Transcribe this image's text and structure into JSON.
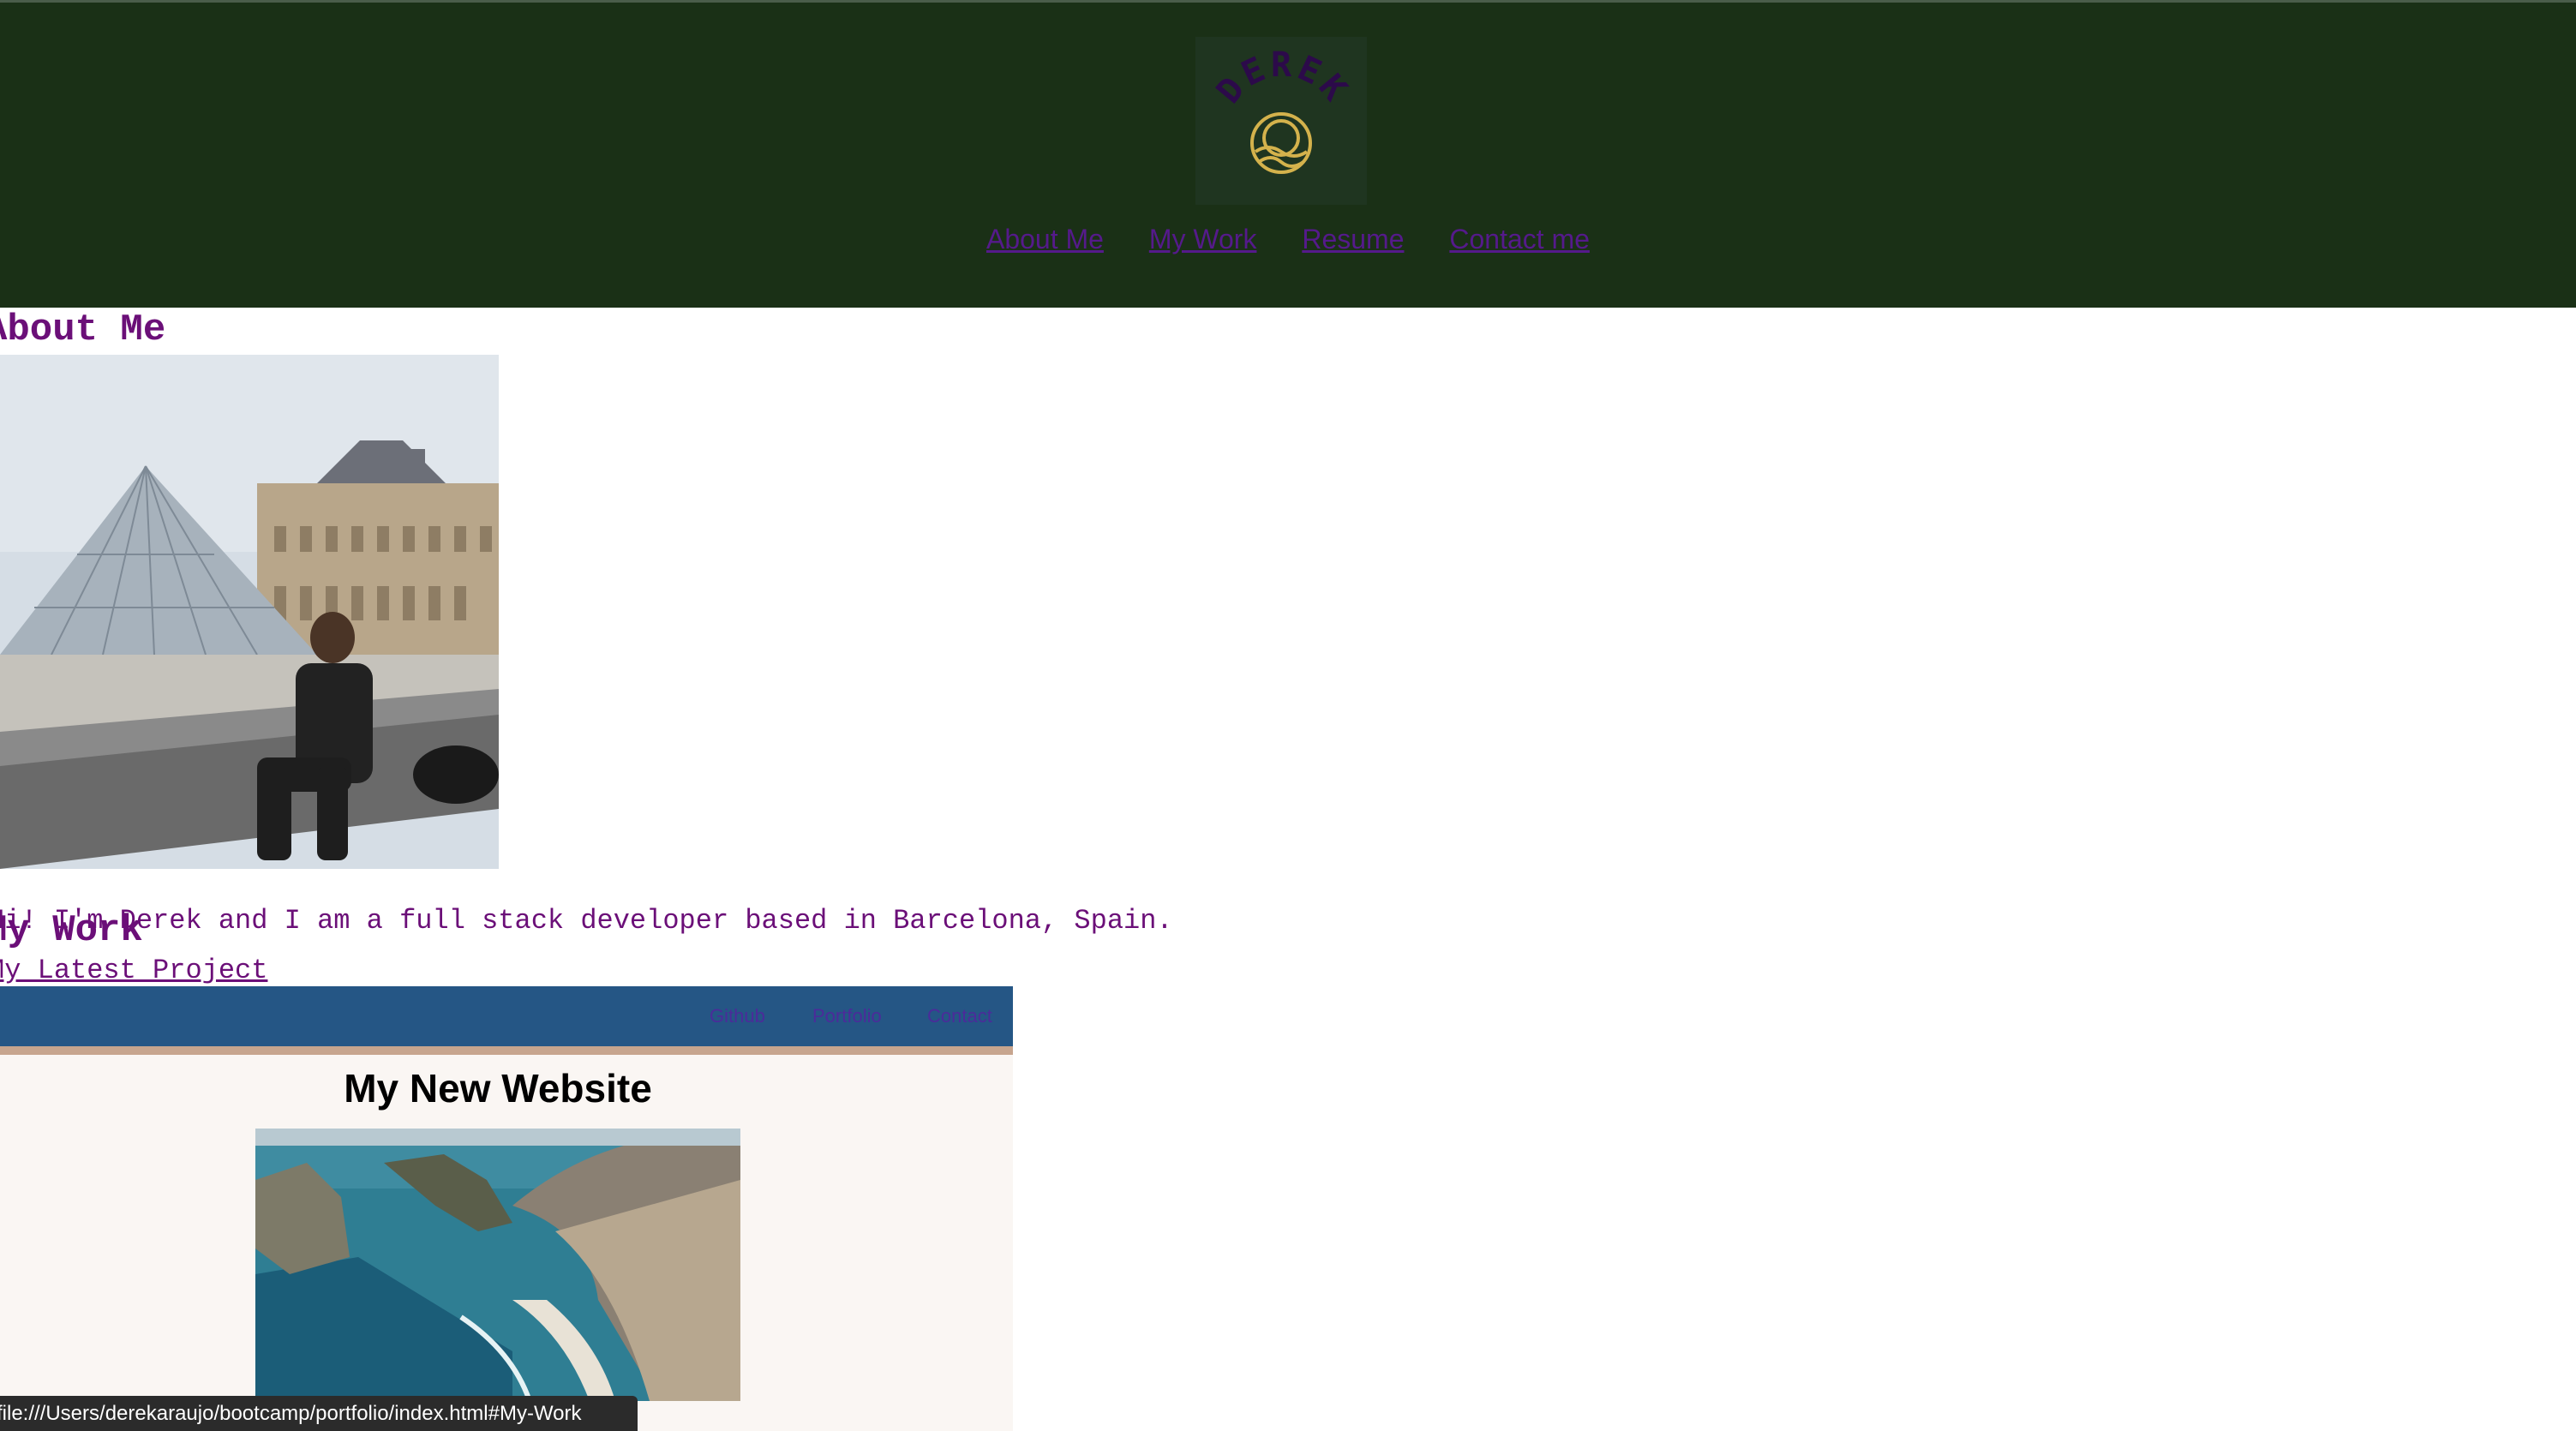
{
  "header": {
    "logo_text": "DEREK",
    "nav": [
      {
        "label": "About Me"
      },
      {
        "label": "My Work"
      },
      {
        "label": "Resume"
      },
      {
        "label": "Contact me"
      }
    ]
  },
  "about": {
    "title": "About Me",
    "text": "Hi! I'm Derek and I am a full stack developer based in Barcelona, Spain."
  },
  "work": {
    "title": "My Work",
    "link": "My Latest Project",
    "preview": {
      "nav": [
        {
          "label": "Github"
        },
        {
          "label": "Portfolio"
        },
        {
          "label": "Contact"
        }
      ],
      "title": "My New Website"
    }
  },
  "status_bar": {
    "url": "file:///Users/derekaraujo/bootcamp/portfolio/index.html#My-Work"
  },
  "colors": {
    "header_bg": "#1a3016",
    "heading": "#6b0f78",
    "link": "#551a8b",
    "preview_nav_bg": "#255685",
    "logo_gold": "#d4b24c",
    "logo_purple": "#2c0a4a"
  }
}
